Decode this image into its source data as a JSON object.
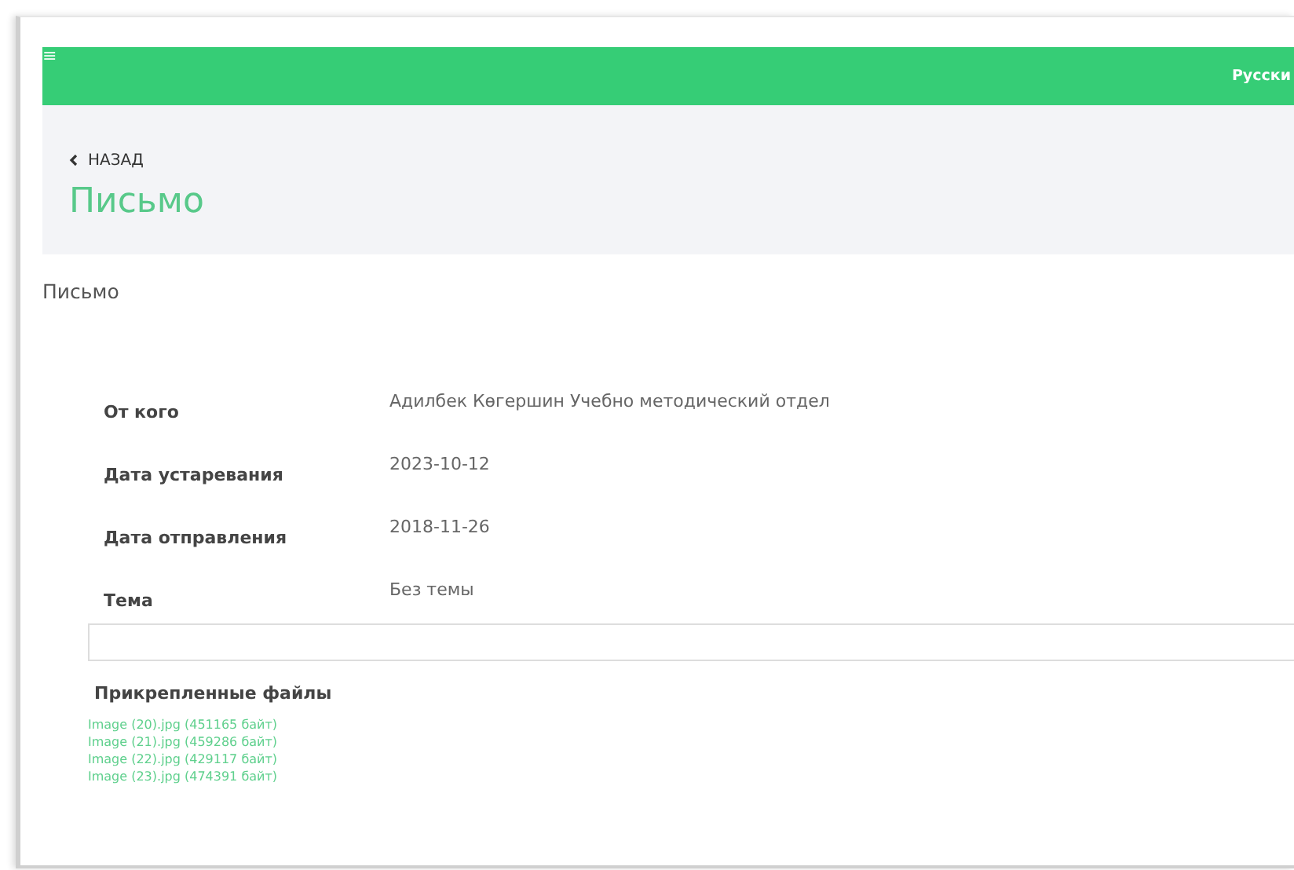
{
  "top_bar": {
    "menu_icon": "≡",
    "language": "Русски"
  },
  "header": {
    "back_link": "НАЗАД",
    "title": "Письмо"
  },
  "section_title": "Письмо",
  "fields": [
    {
      "label": "От кого",
      "value": "Адилбек Көгершин Учебно методический отдел"
    },
    {
      "label": "Дата устаревания",
      "value": "2023-10-12"
    },
    {
      "label": "Дата отправления",
      "value": "2018-11-26"
    },
    {
      "label": "Тема",
      "value": "Без темы"
    }
  ],
  "attachments": {
    "title": "Прикрепленные файлы",
    "files": [
      "Image (20).jpg (451165 байт)",
      "Image (21).jpg (459286 байт)",
      "Image (22).jpg (429117 байт)",
      "Image (23).jpg (474391 байт)"
    ]
  }
}
